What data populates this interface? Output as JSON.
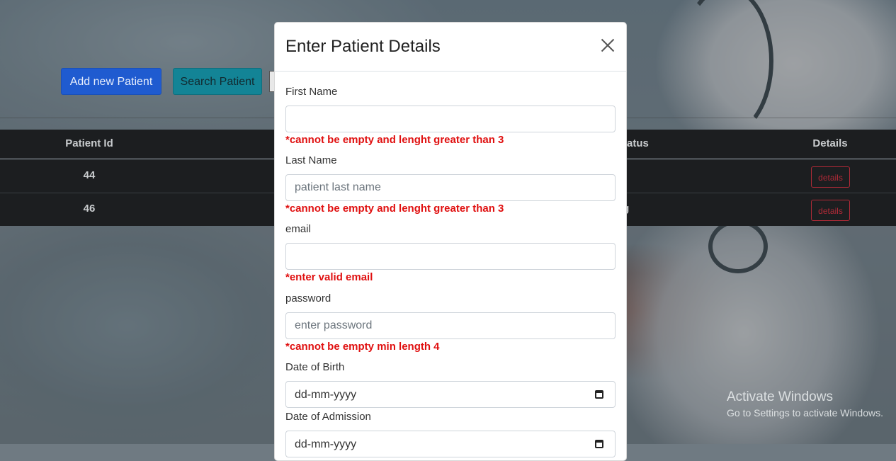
{
  "toolbar": {
    "add_label": "Add new Patient",
    "search_label": "Search Patient"
  },
  "table": {
    "headers": {
      "id": "Patient Id",
      "status": "Status",
      "details": "Details"
    },
    "rows": [
      {
        "id": "44",
        "status": "",
        "details_label": "details"
      },
      {
        "id": "46",
        "status": "ng",
        "details_label": "details"
      }
    ]
  },
  "modal": {
    "title": "Enter Patient Details",
    "fields": {
      "first_name": {
        "label": "First Name",
        "value": "",
        "placeholder": "",
        "error": "*cannot be empty and lenght greater than 3"
      },
      "last_name": {
        "label": "Last Name",
        "value": "",
        "placeholder": "patient last name",
        "error": "*cannot be empty and lenght greater than 3"
      },
      "email": {
        "label": "email",
        "value": "",
        "placeholder": "",
        "error": "*enter valid email"
      },
      "password": {
        "label": "password",
        "value": "",
        "placeholder": "enter password",
        "error": "*cannot be empty min length 4"
      },
      "dob": {
        "label": "Date of Birth",
        "display": "dd-mm-yyyy"
      },
      "doa": {
        "label": "Date of Admission",
        "display": "dd-mm-yyyy"
      }
    }
  },
  "watermark": {
    "line1": "Activate Windows",
    "line2": "Go to Settings to activate Windows."
  },
  "colors": {
    "primary": "#1f5bd0",
    "info": "#138496",
    "danger": "#b02a37",
    "error_text": "#e01010",
    "table_bg": "#1c1e20"
  },
  "icons": [
    "close-icon",
    "calendar-icon"
  ]
}
